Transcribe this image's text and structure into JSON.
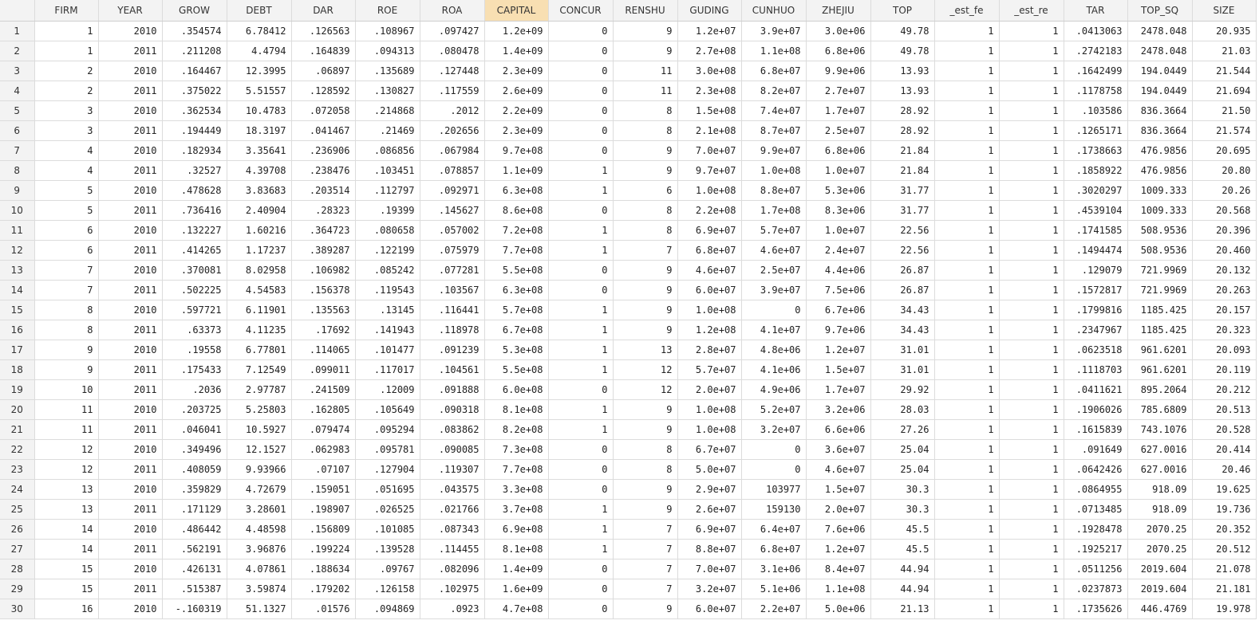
{
  "columns": [
    "FIRM",
    "YEAR",
    "GROW",
    "DEBT",
    "DAR",
    "ROE",
    "ROA",
    "CAPITAL",
    "CONCUR",
    "RENSHU",
    "GUDING",
    "CUNHUO",
    "ZHEJIU",
    "TOP",
    "_est_fe",
    "_est_re",
    "TAR",
    "TOP_SQ",
    "SIZE"
  ],
  "selected_column": "CAPITAL",
  "rows": [
    [
      "1",
      "2010",
      ".354574",
      "6.78412",
      ".126563",
      ".108967",
      ".097427",
      "1.2e+09",
      "0",
      "9",
      "1.2e+07",
      "3.9e+07",
      "3.0e+06",
      "49.78",
      "1",
      "1",
      ".0413063",
      "2478.048",
      "20.935"
    ],
    [
      "1",
      "2011",
      ".211208",
      "4.4794",
      ".164839",
      ".094313",
      ".080478",
      "1.4e+09",
      "0",
      "9",
      "2.7e+08",
      "1.1e+08",
      "6.8e+06",
      "49.78",
      "1",
      "1",
      ".2742183",
      "2478.048",
      "21.03"
    ],
    [
      "2",
      "2010",
      ".164467",
      "12.3995",
      ".06897",
      ".135689",
      ".127448",
      "2.3e+09",
      "0",
      "11",
      "3.0e+08",
      "6.8e+07",
      "9.9e+06",
      "13.93",
      "1",
      "1",
      ".1642499",
      "194.0449",
      "21.544"
    ],
    [
      "2",
      "2011",
      ".375022",
      "5.51557",
      ".128592",
      ".130827",
      ".117559",
      "2.6e+09",
      "0",
      "11",
      "2.3e+08",
      "8.2e+07",
      "2.7e+07",
      "13.93",
      "1",
      "1",
      ".1178758",
      "194.0449",
      "21.694"
    ],
    [
      "3",
      "2010",
      ".362534",
      "10.4783",
      ".072058",
      ".214868",
      ".2012",
      "2.2e+09",
      "0",
      "8",
      "1.5e+08",
      "7.4e+07",
      "1.7e+07",
      "28.92",
      "1",
      "1",
      ".103586",
      "836.3664",
      "21.50"
    ],
    [
      "3",
      "2011",
      ".194449",
      "18.3197",
      ".041467",
      ".21469",
      ".202656",
      "2.3e+09",
      "0",
      "8",
      "2.1e+08",
      "8.7e+07",
      "2.5e+07",
      "28.92",
      "1",
      "1",
      ".1265171",
      "836.3664",
      "21.574"
    ],
    [
      "4",
      "2010",
      ".182934",
      "3.35641",
      ".236906",
      ".086856",
      ".067984",
      "9.7e+08",
      "0",
      "9",
      "7.0e+07",
      "9.9e+07",
      "6.8e+06",
      "21.84",
      "1",
      "1",
      ".1738663",
      "476.9856",
      "20.695"
    ],
    [
      "4",
      "2011",
      ".32527",
      "4.39708",
      ".238476",
      ".103451",
      ".078857",
      "1.1e+09",
      "1",
      "9",
      "9.7e+07",
      "1.0e+08",
      "1.0e+07",
      "21.84",
      "1",
      "1",
      ".1858922",
      "476.9856",
      "20.80"
    ],
    [
      "5",
      "2010",
      ".478628",
      "3.83683",
      ".203514",
      ".112797",
      ".092971",
      "6.3e+08",
      "1",
      "6",
      "1.0e+08",
      "8.8e+07",
      "5.3e+06",
      "31.77",
      "1",
      "1",
      ".3020297",
      "1009.333",
      "20.26"
    ],
    [
      "5",
      "2011",
      ".736416",
      "2.40904",
      ".28323",
      ".19399",
      ".145627",
      "8.6e+08",
      "0",
      "8",
      "2.2e+08",
      "1.7e+08",
      "8.3e+06",
      "31.77",
      "1",
      "1",
      ".4539104",
      "1009.333",
      "20.568"
    ],
    [
      "6",
      "2010",
      ".132227",
      "1.60216",
      ".364723",
      ".080658",
      ".057002",
      "7.2e+08",
      "1",
      "8",
      "6.9e+07",
      "5.7e+07",
      "1.0e+07",
      "22.56",
      "1",
      "1",
      ".1741585",
      "508.9536",
      "20.396"
    ],
    [
      "6",
      "2011",
      ".414265",
      "1.17237",
      ".389287",
      ".122199",
      ".075979",
      "7.7e+08",
      "1",
      "7",
      "6.8e+07",
      "4.6e+07",
      "2.4e+07",
      "22.56",
      "1",
      "1",
      ".1494474",
      "508.9536",
      "20.460"
    ],
    [
      "7",
      "2010",
      ".370081",
      "8.02958",
      ".106982",
      ".085242",
      ".077281",
      "5.5e+08",
      "0",
      "9",
      "4.6e+07",
      "2.5e+07",
      "4.4e+06",
      "26.87",
      "1",
      "1",
      ".129079",
      "721.9969",
      "20.132"
    ],
    [
      "7",
      "2011",
      ".502225",
      "4.54583",
      ".156378",
      ".119543",
      ".103567",
      "6.3e+08",
      "0",
      "9",
      "6.0e+07",
      "3.9e+07",
      "7.5e+06",
      "26.87",
      "1",
      "1",
      ".1572817",
      "721.9969",
      "20.263"
    ],
    [
      "8",
      "2010",
      ".597721",
      "6.11901",
      ".135563",
      ".13145",
      ".116441",
      "5.7e+08",
      "1",
      "9",
      "1.0e+08",
      "0",
      "6.7e+06",
      "34.43",
      "1",
      "1",
      ".1799816",
      "1185.425",
      "20.157"
    ],
    [
      "8",
      "2011",
      ".63373",
      "4.11235",
      ".17692",
      ".141943",
      ".118978",
      "6.7e+08",
      "1",
      "9",
      "1.2e+08",
      "4.1e+07",
      "9.7e+06",
      "34.43",
      "1",
      "1",
      ".2347967",
      "1185.425",
      "20.323"
    ],
    [
      "9",
      "2010",
      ".19558",
      "6.77801",
      ".114065",
      ".101477",
      ".091239",
      "5.3e+08",
      "1",
      "13",
      "2.8e+07",
      "4.8e+06",
      "1.2e+07",
      "31.01",
      "1",
      "1",
      ".0623518",
      "961.6201",
      "20.093"
    ],
    [
      "9",
      "2011",
      ".175433",
      "7.12549",
      ".099011",
      ".117017",
      ".104561",
      "5.5e+08",
      "1",
      "12",
      "5.7e+07",
      "4.1e+06",
      "1.5e+07",
      "31.01",
      "1",
      "1",
      ".1118703",
      "961.6201",
      "20.119"
    ],
    [
      "10",
      "2011",
      ".2036",
      "2.97787",
      ".241509",
      ".12009",
      ".091888",
      "6.0e+08",
      "0",
      "12",
      "2.0e+07",
      "4.9e+06",
      "1.7e+07",
      "29.92",
      "1",
      "1",
      ".0411621",
      "895.2064",
      "20.212"
    ],
    [
      "11",
      "2010",
      ".203725",
      "5.25803",
      ".162805",
      ".105649",
      ".090318",
      "8.1e+08",
      "1",
      "9",
      "1.0e+08",
      "5.2e+07",
      "3.2e+06",
      "28.03",
      "1",
      "1",
      ".1906026",
      "785.6809",
      "20.513"
    ],
    [
      "11",
      "2011",
      ".046041",
      "10.5927",
      ".079474",
      ".095294",
      ".083862",
      "8.2e+08",
      "1",
      "9",
      "1.0e+08",
      "3.2e+07",
      "6.6e+06",
      "27.26",
      "1",
      "1",
      ".1615839",
      "743.1076",
      "20.528"
    ],
    [
      "12",
      "2010",
      ".349496",
      "12.1527",
      ".062983",
      ".095781",
      ".090085",
      "7.3e+08",
      "0",
      "8",
      "6.7e+07",
      "0",
      "3.6e+07",
      "25.04",
      "1",
      "1",
      ".091649",
      "627.0016",
      "20.414"
    ],
    [
      "12",
      "2011",
      ".408059",
      "9.93966",
      ".07107",
      ".127904",
      ".119307",
      "7.7e+08",
      "0",
      "8",
      "5.0e+07",
      "0",
      "4.6e+07",
      "25.04",
      "1",
      "1",
      ".0642426",
      "627.0016",
      "20.46"
    ],
    [
      "13",
      "2010",
      ".359829",
      "4.72679",
      ".159051",
      ".051695",
      ".043575",
      "3.3e+08",
      "0",
      "9",
      "2.9e+07",
      "103977",
      "1.5e+07",
      "30.3",
      "1",
      "1",
      ".0864955",
      "918.09",
      "19.625"
    ],
    [
      "13",
      "2011",
      ".171129",
      "3.28601",
      ".198907",
      ".026525",
      ".021766",
      "3.7e+08",
      "1",
      "9",
      "2.6e+07",
      "159130",
      "2.0e+07",
      "30.3",
      "1",
      "1",
      ".0713485",
      "918.09",
      "19.736"
    ],
    [
      "14",
      "2010",
      ".486442",
      "4.48598",
      ".156809",
      ".101085",
      ".087343",
      "6.9e+08",
      "1",
      "7",
      "6.9e+07",
      "6.4e+07",
      "7.6e+06",
      "45.5",
      "1",
      "1",
      ".1928478",
      "2070.25",
      "20.352"
    ],
    [
      "14",
      "2011",
      ".562191",
      "3.96876",
      ".199224",
      ".139528",
      ".114455",
      "8.1e+08",
      "1",
      "7",
      "8.8e+07",
      "6.8e+07",
      "1.2e+07",
      "45.5",
      "1",
      "1",
      ".1925217",
      "2070.25",
      "20.512"
    ],
    [
      "15",
      "2010",
      ".426131",
      "4.07861",
      ".188634",
      ".09767",
      ".082096",
      "1.4e+09",
      "0",
      "7",
      "7.0e+07",
      "3.1e+06",
      "8.4e+07",
      "44.94",
      "1",
      "1",
      ".0511256",
      "2019.604",
      "21.078"
    ],
    [
      "15",
      "2011",
      ".515387",
      "3.59874",
      ".179202",
      ".126158",
      ".102975",
      "1.6e+09",
      "0",
      "7",
      "3.2e+07",
      "5.1e+06",
      "1.1e+08",
      "44.94",
      "1",
      "1",
      ".0237873",
      "2019.604",
      "21.181"
    ],
    [
      "16",
      "2010",
      "-.160319",
      "51.1327",
      ".01576",
      ".094869",
      ".0923",
      "4.7e+08",
      "0",
      "9",
      "6.0e+07",
      "2.2e+07",
      "5.0e+06",
      "21.13",
      "1",
      "1",
      ".1735626",
      "446.4769",
      "19.978"
    ]
  ]
}
